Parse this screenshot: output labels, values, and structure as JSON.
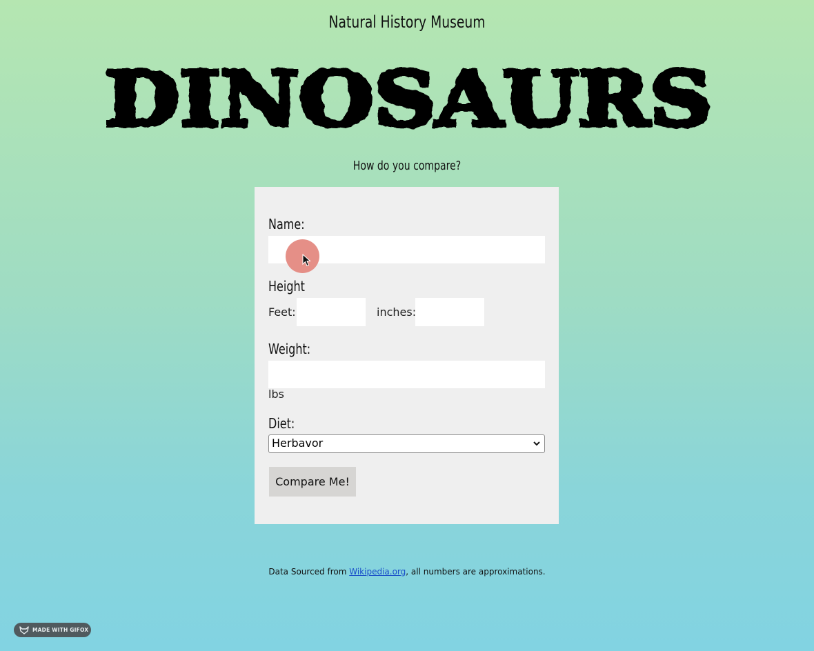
{
  "header": {
    "museum_title": "Natural History Museum",
    "logo_text": "DINOSAURS",
    "subtitle": "How do you compare?"
  },
  "form": {
    "name_label": "Name:",
    "name_value": "",
    "height_label": "Height",
    "feet_label": "Feet:",
    "feet_value": "",
    "inches_label": "inches:",
    "inches_value": "",
    "weight_label": "Weight:",
    "weight_value": "",
    "weight_unit": "lbs",
    "diet_label": "Diet:",
    "diet_selected": "Herbavor",
    "submit_label": "Compare Me!"
  },
  "footer": {
    "prefix": "Data Sourced from ",
    "link_text": "Wikipedia.org",
    "suffix": ", all numbers are approximations."
  },
  "badge": {
    "text": "MADE WITH GIFOX"
  },
  "colors": {
    "gradient_top": "#b5e6b1",
    "gradient_bottom": "#82d3e2",
    "panel": "#efefef",
    "button": "#d6d5d3",
    "cursor_halo": "#e58f87",
    "link": "#1a4fc9"
  }
}
